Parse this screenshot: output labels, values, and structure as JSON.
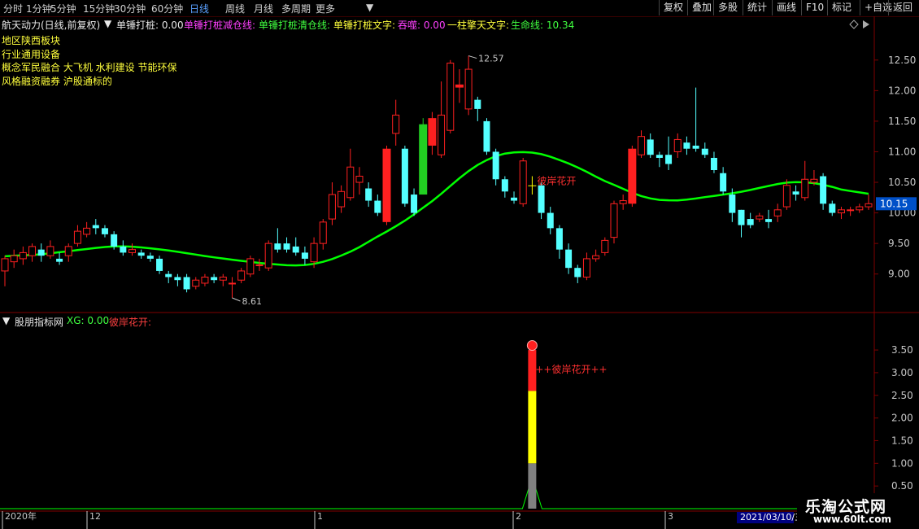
{
  "toolbar": {
    "periods": [
      "分时",
      "1分钟",
      "5分钟",
      "15分钟",
      "30分钟",
      "60分钟",
      "日线",
      "周线",
      "月线",
      "多周期",
      "更多"
    ],
    "active_period": "日线",
    "right_buttons": [
      "复权",
      "叠加",
      "多股",
      "统计",
      "画线",
      "F10",
      "标记",
      "+自选",
      "返回"
    ]
  },
  "main_header": {
    "stock": "航天动力(日线,前复权)",
    "indicator": "单锤打桩",
    "value": "单锤打桩: 0.00",
    "reduce_label": "单锤打桩减仓线:",
    "clear_label": "单锤打桩清仓线:",
    "text_label": "单锤打桩文字:",
    "tunshi": "吞噬: 0.00",
    "yizhu": "一柱擎天文字:",
    "shengming": "生命线: 10.34"
  },
  "info_lines": [
    "地区陕西板块",
    "行业通用设备",
    "概念军民融合 大飞机 水利建设 节能环保",
    "风格融资融券 沪股通标的"
  ],
  "sub_header": {
    "name": "股朋指标网",
    "xg": "XG: 0.00",
    "signal": "彼岸花开:"
  },
  "annotations": {
    "high_label": "12.57",
    "low_label": "8.61",
    "main_signal": "彼岸花开",
    "sub_signal": "++彼岸花开++",
    "current_price": "10.15"
  },
  "x_axis_labels": [
    "2020年",
    "12",
    "1",
    "2",
    "3",
    "2021/03/10/三"
  ],
  "watermark": {
    "main": "乐淘公式网",
    "url": "www.60lt.com"
  },
  "colors": {
    "up": "#ff2020",
    "down": "#54ffff",
    "line": "#00ff00",
    "signal": "#ffff00",
    "grid": "#800000"
  },
  "chart_data": [
    {
      "type": "candlestick",
      "title": "航天动力(日线,前复权)",
      "y_ticks": [
        9.0,
        9.5,
        10.0,
        10.5,
        11.0,
        11.5,
        12.0,
        12.5
      ],
      "ylim": [
        8.45,
        12.95
      ],
      "high": 12.57,
      "low": 8.61,
      "last": 10.15,
      "life_line_last": 10.34,
      "candles": [
        [
          9.05,
          9.25,
          9.3,
          8.8
        ],
        [
          9.2,
          9.3,
          9.4,
          9.1
        ],
        [
          9.25,
          9.35,
          9.45,
          9.15
        ],
        [
          9.3,
          9.45,
          9.5,
          9.2
        ],
        [
          9.4,
          9.3,
          9.5,
          9.2
        ],
        [
          9.3,
          9.45,
          9.55,
          9.25
        ],
        [
          9.25,
          9.2,
          9.35,
          9.15
        ],
        [
          9.3,
          9.45,
          9.5,
          9.2
        ],
        [
          9.5,
          9.7,
          9.8,
          9.45
        ],
        [
          9.65,
          9.75,
          9.85,
          9.6
        ],
        [
          9.8,
          9.75,
          9.9,
          9.65
        ],
        [
          9.75,
          9.65,
          9.8,
          9.6
        ],
        [
          9.65,
          9.45,
          9.7,
          9.4
        ],
        [
          9.45,
          9.35,
          9.55,
          9.3
        ],
        [
          9.35,
          9.4,
          9.5,
          9.3
        ],
        [
          9.35,
          9.3,
          9.4,
          9.25
        ],
        [
          9.3,
          9.25,
          9.35,
          9.2
        ],
        [
          9.25,
          9.05,
          9.3,
          9.0
        ],
        [
          9.0,
          8.95,
          9.05,
          8.85
        ],
        [
          8.95,
          8.9,
          9.0,
          8.8
        ],
        [
          8.95,
          8.75,
          9.0,
          8.7
        ],
        [
          8.8,
          8.9,
          8.95,
          8.75
        ],
        [
          8.85,
          8.95,
          9.0,
          8.8
        ],
        [
          8.95,
          8.9,
          9.0,
          8.85
        ],
        [
          8.9,
          8.95,
          9.0,
          8.8
        ],
        [
          8.85,
          8.85,
          8.95,
          8.61
        ],
        [
          8.9,
          9.05,
          9.1,
          8.85
        ],
        [
          9.0,
          9.25,
          9.3,
          8.95
        ],
        [
          9.15,
          9.15,
          9.25,
          9.05
        ],
        [
          9.1,
          9.5,
          9.55,
          9.05
        ],
        [
          9.5,
          9.4,
          9.75,
          9.35
        ],
        [
          9.5,
          9.4,
          9.6,
          9.35
        ],
        [
          9.45,
          9.35,
          9.6,
          9.3
        ],
        [
          9.35,
          9.25,
          9.45,
          9.15
        ],
        [
          9.2,
          9.5,
          9.6,
          9.1
        ],
        [
          9.5,
          9.85,
          9.9,
          9.4
        ],
        [
          9.9,
          10.3,
          10.5,
          9.8
        ],
        [
          10.1,
          10.35,
          10.45,
          10.0
        ],
        [
          10.25,
          10.75,
          11.05,
          10.2
        ],
        [
          10.5,
          10.6,
          10.75,
          10.3
        ],
        [
          10.4,
          10.2,
          10.5,
          10.1
        ],
        [
          10.2,
          10.0,
          10.3,
          9.95
        ],
        [
          9.85,
          11.05,
          11.1,
          9.8
        ],
        [
          11.3,
          11.6,
          11.85,
          11.1
        ],
        [
          11.05,
          10.15,
          11.1,
          10.1
        ],
        [
          10.3,
          10.0,
          10.4,
          9.95
        ],
        [
          10.3,
          11.45,
          11.55,
          10.3
        ],
        [
          11.1,
          11.55,
          11.65,
          10.95
        ],
        [
          10.95,
          11.6,
          12.15,
          10.9
        ],
        [
          11.35,
          12.45,
          12.5,
          11.3
        ],
        [
          12.05,
          12.1,
          12.35,
          11.8
        ],
        [
          11.7,
          12.35,
          12.57,
          11.6
        ],
        [
          11.85,
          11.7,
          11.9,
          11.5
        ],
        [
          11.5,
          11.0,
          11.55,
          10.95
        ],
        [
          11.0,
          10.55,
          11.05,
          10.45
        ],
        [
          10.55,
          10.35,
          10.6,
          10.25
        ],
        [
          10.25,
          10.2,
          10.35,
          10.15
        ],
        [
          10.15,
          10.85,
          10.9,
          10.1
        ],
        [
          10.45,
          10.45,
          10.6,
          10.3
        ],
        [
          10.45,
          10.0,
          10.5,
          9.9
        ],
        [
          10.0,
          9.75,
          10.1,
          9.65
        ],
        [
          9.75,
          9.4,
          9.8,
          9.25
        ],
        [
          9.4,
          9.1,
          9.5,
          9.0
        ],
        [
          9.1,
          8.95,
          9.15,
          8.85
        ],
        [
          8.95,
          9.25,
          9.35,
          8.9
        ],
        [
          9.25,
          9.3,
          9.4,
          9.2
        ],
        [
          9.35,
          9.55,
          9.6,
          9.3
        ],
        [
          9.6,
          10.15,
          10.2,
          9.5
        ],
        [
          10.15,
          10.2,
          10.3,
          10.05
        ],
        [
          10.15,
          11.05,
          11.1,
          10.1
        ],
        [
          10.95,
          11.25,
          11.35,
          10.9
        ],
        [
          11.2,
          10.95,
          11.3,
          10.9
        ],
        [
          10.95,
          10.9,
          11.0,
          10.75
        ],
        [
          10.95,
          10.8,
          11.25,
          10.7
        ],
        [
          11.0,
          11.2,
          11.3,
          10.9
        ],
        [
          11.15,
          11.05,
          11.25,
          10.95
        ],
        [
          11.1,
          11.05,
          12.05,
          11.0
        ],
        [
          11.05,
          10.95,
          11.15,
          10.9
        ],
        [
          10.9,
          10.7,
          11.0,
          10.65
        ],
        [
          10.65,
          10.35,
          10.75,
          10.3
        ],
        [
          10.3,
          10.0,
          10.4,
          9.85
        ],
        [
          10.05,
          9.8,
          10.05,
          9.6
        ],
        [
          9.9,
          9.8,
          10.0,
          9.75
        ],
        [
          9.9,
          9.95,
          10.0,
          9.85
        ],
        [
          9.9,
          9.85,
          10.05,
          9.75
        ],
        [
          9.95,
          10.05,
          10.15,
          9.85
        ],
        [
          10.1,
          10.45,
          10.55,
          10.05
        ],
        [
          10.35,
          10.3,
          10.45,
          10.2
        ],
        [
          10.25,
          10.55,
          10.85,
          10.2
        ],
        [
          10.5,
          10.55,
          10.7,
          10.45
        ],
        [
          10.6,
          10.15,
          10.65,
          10.05
        ],
        [
          10.15,
          10.0,
          10.2,
          9.95
        ],
        [
          10.0,
          10.05,
          10.1,
          9.9
        ],
        [
          10.05,
          10.05,
          10.1,
          9.95
        ],
        [
          10.05,
          10.1,
          10.15,
          10.0
        ],
        [
          10.1,
          10.15,
          10.3,
          10.05
        ]
      ],
      "signal_candle_index": 58
    },
    {
      "type": "bar",
      "title": "股朋指标网",
      "y_ticks": [
        0.5,
        1.0,
        1.5,
        2.0,
        2.5,
        3.0,
        3.5
      ],
      "ylim": [
        0.0,
        3.95
      ],
      "signal_index": 58,
      "segments": [
        {
          "from": 0.0,
          "to": 1.0,
          "color": "#808080"
        },
        {
          "from": 1.0,
          "to": 2.6,
          "color": "#ffff00"
        },
        {
          "from": 2.6,
          "to": 3.5,
          "color": "#ff2020"
        }
      ],
      "signal_ball_value": 3.6,
      "triangle_peak": 0.7
    }
  ]
}
